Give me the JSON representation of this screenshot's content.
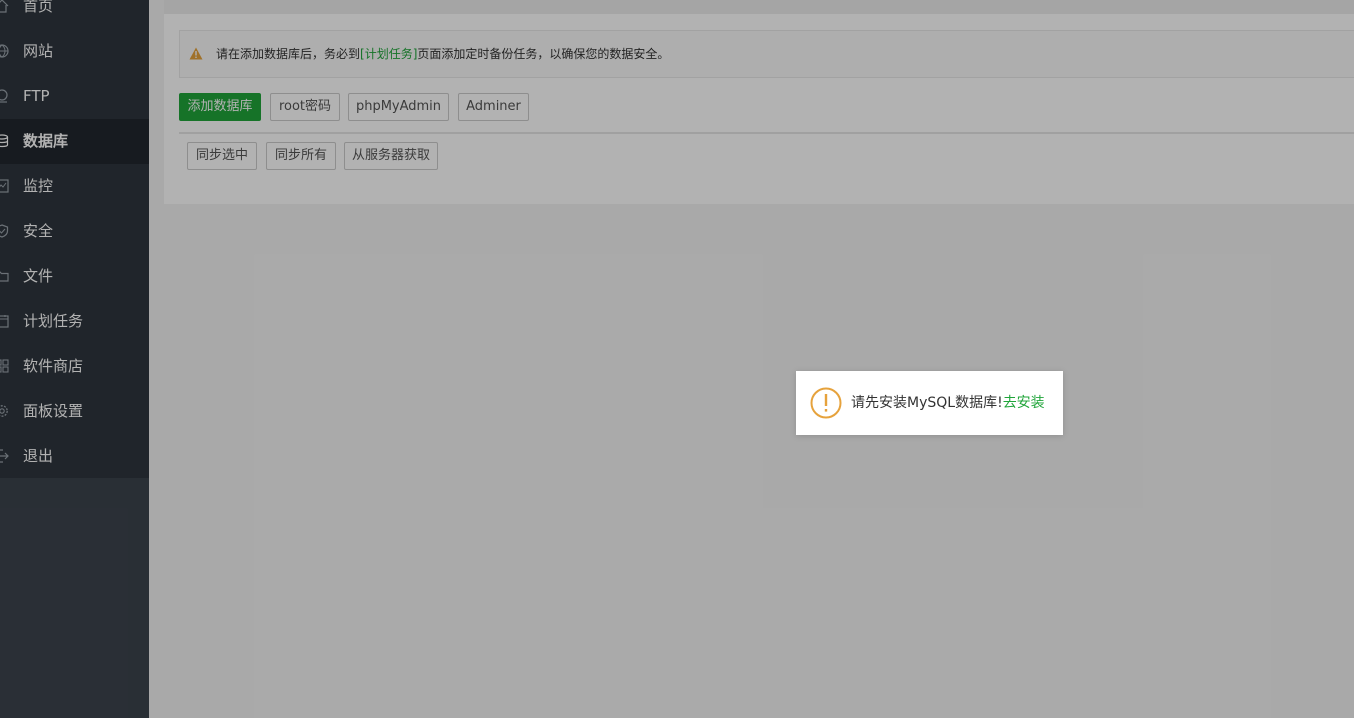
{
  "sidebar": {
    "items": [
      {
        "label": "首页",
        "icon": "home-icon"
      },
      {
        "label": "网站",
        "icon": "globe-icon"
      },
      {
        "label": "FTP",
        "icon": "ftp-icon"
      },
      {
        "label": "数据库",
        "icon": "database-icon",
        "active": true
      },
      {
        "label": "监控",
        "icon": "monitor-chart-icon"
      },
      {
        "label": "安全",
        "icon": "shield-icon"
      },
      {
        "label": "文件",
        "icon": "folder-icon"
      },
      {
        "label": "计划任务",
        "icon": "calendar-icon"
      },
      {
        "label": "软件商店",
        "icon": "grid-icon"
      },
      {
        "label": "面板设置",
        "icon": "gear-icon"
      },
      {
        "label": "退出",
        "icon": "logout-icon"
      }
    ]
  },
  "alert": {
    "prefix": "请在添加数据库后，务必到",
    "link": "[计划任务]",
    "suffix": "页面添加定时备份任务，以确保您的数据安全。"
  },
  "toolbar": {
    "add_database": "添加数据库",
    "root_password": "root密码",
    "phpmyadmin": "phpMyAdmin",
    "adminer": "Adminer"
  },
  "sync": {
    "sync_selected": "同步选中",
    "sync_all": "同步所有",
    "fetch_from_server": "从服务器获取"
  },
  "dialog": {
    "message": "请先安装MySQL数据库!",
    "link": "去安装"
  },
  "colors": {
    "accent": "#20a53a",
    "warning": "#e6a23c",
    "sidebar": "#2f363e"
  }
}
